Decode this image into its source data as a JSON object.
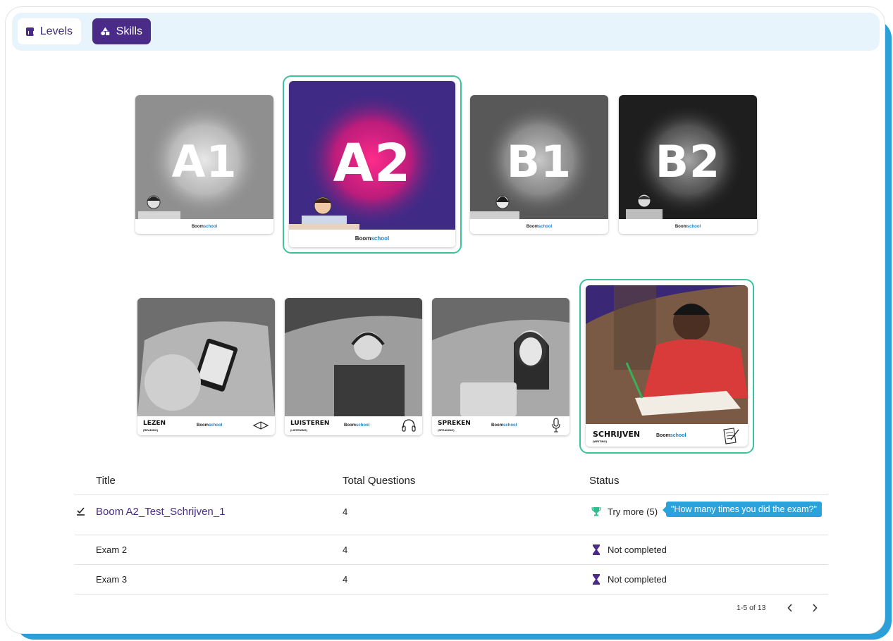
{
  "tabs": {
    "levels_label": "Levels",
    "skills_label": "Skills"
  },
  "levels": [
    {
      "label": "A1",
      "brand_a": "Boom",
      "brand_b": "school",
      "tone": "#9a9a9a"
    },
    {
      "label": "A2",
      "brand_a": "Boom",
      "brand_b": "school",
      "tone": "#3f2a86"
    },
    {
      "label": "B1",
      "brand_a": "Boom",
      "brand_b": "school",
      "tone": "#5b5b5b"
    },
    {
      "label": "B2",
      "brand_a": "Boom",
      "brand_b": "school",
      "tone": "#1e1e1e"
    }
  ],
  "skills": [
    {
      "title": "LEZEN",
      "sub": "(READING)",
      "brand_a": "Boom",
      "brand_b": "school",
      "icon": "book-icon"
    },
    {
      "title": "LUISTEREN",
      "sub": "(LISTENING)",
      "brand_a": "Boom",
      "brand_b": "school",
      "icon": "headphones-icon"
    },
    {
      "title": "SPREKEN",
      "sub": "(SPEAKING)",
      "brand_a": "Boom",
      "brand_b": "school",
      "icon": "microphone-icon"
    },
    {
      "title": "SCHRIJVEN",
      "sub": "(WRITING)",
      "brand_a": "Boom",
      "brand_b": "school",
      "icon": "pen-paper-icon"
    }
  ],
  "table": {
    "headers": {
      "title": "Title",
      "total": "Total Questions",
      "status": "Status"
    },
    "rows": [
      {
        "title": "Boom A2_Test_Schrijven_1",
        "total": "4",
        "status": "Try more (5)",
        "status_icon": "trophy-icon"
      },
      {
        "title": "Exam 2",
        "total": "4",
        "status": "Not completed",
        "status_icon": "hourglass-icon"
      },
      {
        "title": "Exam 3",
        "total": "4",
        "status": "Not completed",
        "status_icon": "hourglass-icon"
      }
    ],
    "tooltip": "\"How many times you did the exam?\"",
    "pagination": "1-5 of 13"
  },
  "colors": {
    "brand_purple": "#4a2b88",
    "selection_green": "#3cc39b",
    "accent_blue": "#2aa3dd",
    "trophy_green": "#2ebd8c",
    "frame_blue": "#2a9fd8"
  }
}
